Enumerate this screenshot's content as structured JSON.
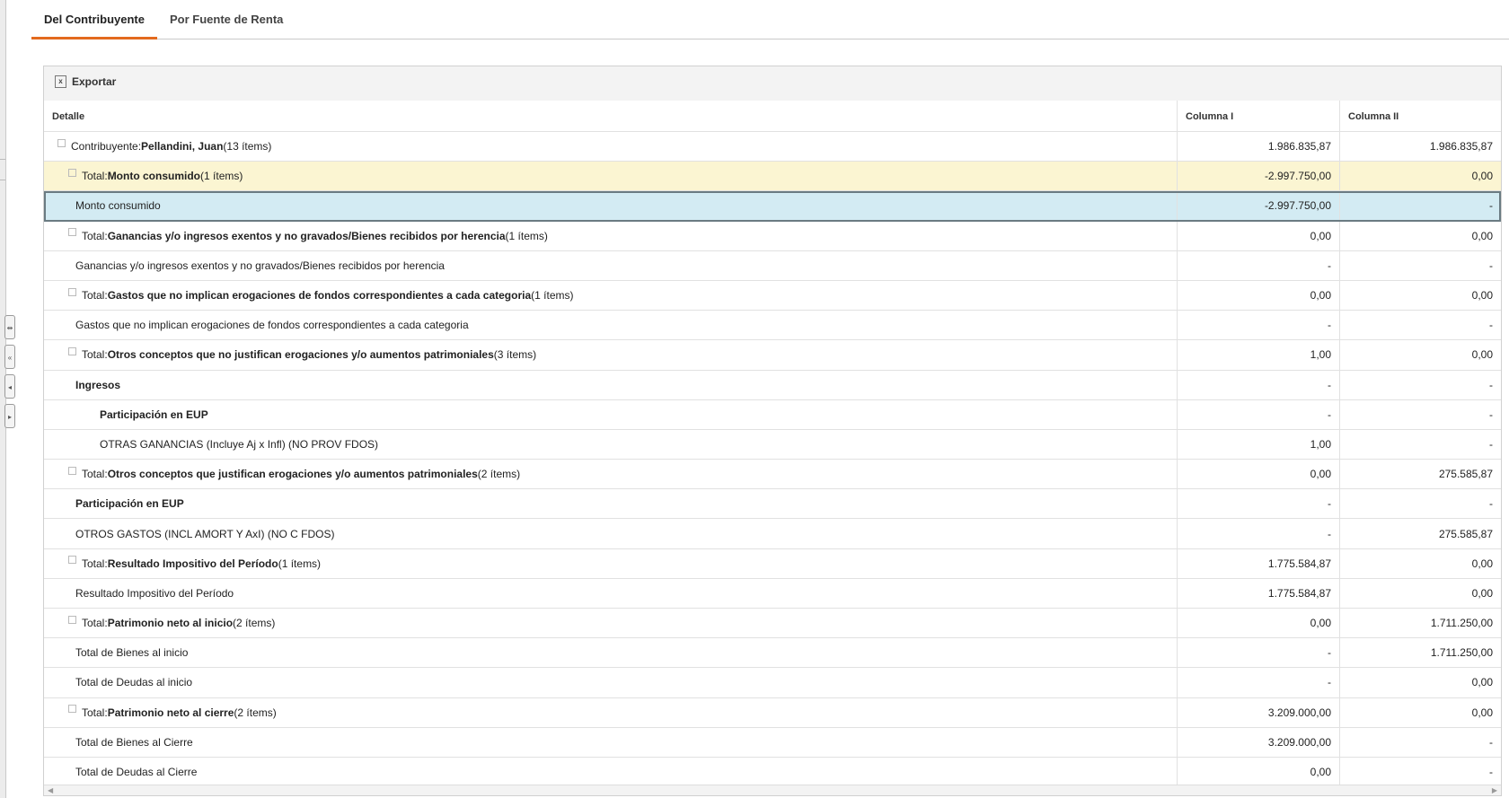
{
  "tabs": [
    {
      "label": "Del Contribuyente",
      "active": true
    },
    {
      "label": "Por Fuente de Renta",
      "active": false
    }
  ],
  "toolbar": {
    "export_label": "Exportar"
  },
  "columns": [
    "Detalle",
    "Columna I",
    "Columna II"
  ],
  "rows": [
    {
      "prefix": "Contribuyente: ",
      "name": "Pellandini, Juan",
      "suffix": " (13 ítems)",
      "col1": "1.986.835,87",
      "col2": "1.986.835,87"
    },
    {
      "prefix": "Total: ",
      "name": "Monto consumido",
      "suffix": " (1 ítems)",
      "col1": "-2.997.750,00",
      "col2": "0,00"
    },
    {
      "prefix": "",
      "name": "Monto consumido",
      "suffix": "",
      "col1": "-2.997.750,00",
      "col2": "-"
    },
    {
      "prefix": "Total: ",
      "name": "Ganancias y/o ingresos exentos y no gravados/Bienes recibidos por herencia",
      "suffix": " (1 ítems)",
      "col1": "0,00",
      "col2": "0,00"
    },
    {
      "prefix": "",
      "name": "Ganancias y/o ingresos exentos y no gravados/Bienes recibidos por herencia",
      "suffix": "",
      "col1": "-",
      "col2": "-"
    },
    {
      "prefix": "Total: ",
      "name": "Gastos que no implican erogaciones de fondos correspondientes a cada categoria",
      "suffix": " (1 ítems)",
      "col1": "0,00",
      "col2": "0,00"
    },
    {
      "prefix": "",
      "name": "Gastos que no implican erogaciones de fondos correspondientes a cada categoria",
      "suffix": "",
      "col1": "-",
      "col2": "-"
    },
    {
      "prefix": "Total: ",
      "name": "Otros conceptos que no justifican erogaciones y/o aumentos patrimoniales",
      "suffix": " (3 ítems)",
      "col1": "1,00",
      "col2": "0,00"
    },
    {
      "prefix": "",
      "name": "Ingresos",
      "suffix": "",
      "col1": "-",
      "col2": "-"
    },
    {
      "prefix": "",
      "name": "Participación en EUP",
      "suffix": "",
      "col1": "-",
      "col2": "-"
    },
    {
      "prefix": "",
      "name": "OTRAS GANANCIAS (Incluye Aj x Infl) (NO PROV FDOS)",
      "suffix": "",
      "col1": "1,00",
      "col2": "-"
    },
    {
      "prefix": "Total: ",
      "name": "Otros conceptos que justifican erogaciones y/o aumentos patrimoniales",
      "suffix": " (2 ítems)",
      "col1": "0,00",
      "col2": "275.585,87"
    },
    {
      "prefix": "",
      "name": "Participación en EUP",
      "suffix": "",
      "col1": "-",
      "col2": "-"
    },
    {
      "prefix": "",
      "name": "OTROS GASTOS (INCL AMORT Y AxI) (NO C FDOS)",
      "suffix": "",
      "col1": "-",
      "col2": "275.585,87"
    },
    {
      "prefix": "Total: ",
      "name": "Resultado Impositivo del Período",
      "suffix": " (1 ítems)",
      "col1": "1.775.584,87",
      "col2": "0,00"
    },
    {
      "prefix": "",
      "name": "Resultado Impositivo del Período",
      "suffix": "",
      "col1": "1.775.584,87",
      "col2": "0,00"
    },
    {
      "prefix": "Total: ",
      "name": "Patrimonio neto al inicio",
      "suffix": " (2 ítems)",
      "col1": "0,00",
      "col2": "1.711.250,00"
    },
    {
      "prefix": "",
      "name": "Total de Bienes al inicio",
      "suffix": "",
      "col1": "-",
      "col2": "1.711.250,00"
    },
    {
      "prefix": "",
      "name": "Total de Deudas al inicio",
      "suffix": "",
      "col1": "-",
      "col2": "0,00"
    },
    {
      "prefix": "Total: ",
      "name": "Patrimonio neto al cierre",
      "suffix": " (2 ítems)",
      "col1": "3.209.000,00",
      "col2": "0,00"
    },
    {
      "prefix": "",
      "name": "Total de Bienes al Cierre",
      "suffix": "",
      "col1": "3.209.000,00",
      "col2": "-"
    },
    {
      "prefix": "",
      "name": "Total de Deudas al Cierre",
      "suffix": "",
      "col1": "0,00",
      "col2": "-"
    }
  ]
}
